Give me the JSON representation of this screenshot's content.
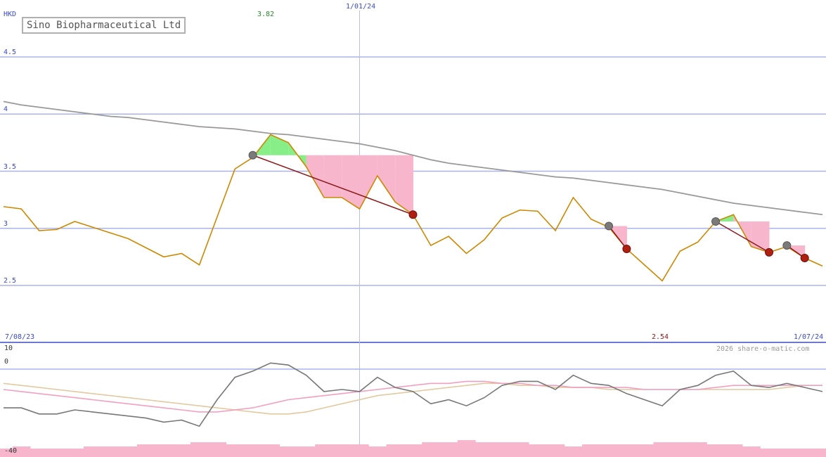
{
  "chart_data": {
    "type": "line",
    "title": "Sino Biopharmaceutical Ltd",
    "currency": "HKD",
    "x_start_label": "7/08/23",
    "x_mid_label": "1/01/24",
    "x_end_label": "1/07/24",
    "high_label": "3.82",
    "low_label": "2.54",
    "copyright": "2026 share-o-matic.com",
    "price_ticks": [
      "4.5",
      "4",
      "3.5",
      "3",
      "2.5"
    ],
    "ylim": [
      2.5,
      4.5
    ],
    "grid": true,
    "indicator_ticks": [
      "10",
      "0",
      "-40"
    ],
    "x_weeks": [
      0,
      1,
      2,
      3,
      4,
      5,
      6,
      7,
      8,
      9,
      10,
      11,
      12,
      13,
      14,
      15,
      16,
      17,
      18,
      19,
      20,
      21,
      22,
      23,
      24,
      25,
      26,
      27,
      28,
      29,
      30,
      31,
      32,
      33,
      34,
      35,
      36,
      37,
      38,
      39,
      40,
      41,
      42,
      43,
      44,
      45,
      46
    ],
    "series": [
      {
        "name": "price",
        "color": "#cc8800",
        "values": [
          3.19,
          3.17,
          2.98,
          2.99,
          3.06,
          3.01,
          2.96,
          2.91,
          2.83,
          2.75,
          2.78,
          2.68,
          3.1,
          3.52,
          3.62,
          3.82,
          3.75,
          3.54,
          3.27,
          3.27,
          3.17,
          3.46,
          3.23,
          3.12,
          2.85,
          2.93,
          2.78,
          2.9,
          3.09,
          3.16,
          3.15,
          2.98,
          3.27,
          3.08,
          3.01,
          2.82,
          2.68,
          2.54,
          2.8,
          2.88,
          3.06,
          3.12,
          2.84,
          2.79,
          2.84,
          2.74,
          2.67
        ]
      },
      {
        "name": "moving-average",
        "color": "#999999",
        "values": [
          4.11,
          4.08,
          4.06,
          4.04,
          4.02,
          4.0,
          3.98,
          3.97,
          3.95,
          3.93,
          3.91,
          3.89,
          3.88,
          3.87,
          3.85,
          3.83,
          3.82,
          3.8,
          3.78,
          3.76,
          3.74,
          3.71,
          3.68,
          3.64,
          3.6,
          3.57,
          3.55,
          3.53,
          3.51,
          3.49,
          3.47,
          3.45,
          3.44,
          3.42,
          3.4,
          3.38,
          3.36,
          3.34,
          3.31,
          3.28,
          3.25,
          3.22,
          3.2,
          3.18,
          3.16,
          3.14,
          3.12
        ]
      }
    ],
    "trades": [
      {
        "buy_week": 14,
        "buy_price": 3.64,
        "sell_week": 23,
        "sell_price": 3.12
      },
      {
        "buy_week": 34,
        "buy_price": 3.02,
        "sell_week": 35,
        "sell_price": 2.82
      },
      {
        "buy_week": 40,
        "buy_price": 3.06,
        "sell_week": 43,
        "sell_price": 2.79
      },
      {
        "buy_week": 44,
        "buy_price": 2.85,
        "sell_week": 45,
        "sell_price": 2.74
      }
    ],
    "indicator": {
      "ylim": [
        -40,
        10
      ],
      "series": [
        {
          "name": "oscillator",
          "color": "#777777",
          "values": [
            -19,
            -19,
            -22,
            -22,
            -20,
            -21,
            -22,
            -23,
            -24,
            -26,
            -25,
            -28,
            -15,
            -4,
            -1,
            3,
            2,
            -3,
            -11,
            -10,
            -11,
            -4,
            -9,
            -11,
            -17,
            -15,
            -18,
            -14,
            -8,
            -6,
            -6,
            -10,
            -3,
            -7,
            -8,
            -12,
            -15,
            -18,
            -10,
            -8,
            -3,
            -1,
            -8,
            -9,
            -7,
            -9,
            -11
          ]
        },
        {
          "name": "signal-1",
          "color": "#f2a0c0",
          "values": [
            -10,
            -11,
            -12,
            -13,
            -14,
            -15,
            -16,
            -17,
            -18,
            -19,
            -20,
            -21,
            -21,
            -20,
            -19,
            -17,
            -15,
            -14,
            -13,
            -12,
            -11,
            -10,
            -9,
            -8,
            -7,
            -7,
            -6,
            -6,
            -7,
            -7,
            -8,
            -8,
            -9,
            -9,
            -9,
            -9,
            -10,
            -10,
            -10,
            -10,
            -9,
            -8,
            -8,
            -8,
            -8,
            -8,
            -8
          ]
        },
        {
          "name": "signal-2",
          "color": "#e2c9a0",
          "values": [
            -7,
            -8,
            -9,
            -10,
            -11,
            -12,
            -13,
            -14,
            -15,
            -16,
            -17,
            -18,
            -19,
            -20,
            -21,
            -22,
            -22,
            -21,
            -19,
            -17,
            -15,
            -13,
            -12,
            -11,
            -10,
            -9,
            -8,
            -7,
            -7,
            -8,
            -8,
            -9,
            -9,
            -9,
            -10,
            -10,
            -10,
            -10,
            -10,
            -10,
            -10,
            -10,
            -10,
            -10,
            -9,
            -8,
            -8
          ]
        }
      ],
      "bars": [
        2,
        3,
        2,
        2,
        2,
        3,
        3,
        3,
        4,
        4,
        4,
        5,
        5,
        4,
        4,
        4,
        3,
        3,
        4,
        4,
        4,
        3,
        4,
        4,
        5,
        5,
        6,
        5,
        5,
        5,
        4,
        4,
        3,
        4,
        4,
        4,
        4,
        5,
        5,
        5,
        4,
        4,
        3,
        2,
        2,
        2,
        2
      ]
    }
  }
}
